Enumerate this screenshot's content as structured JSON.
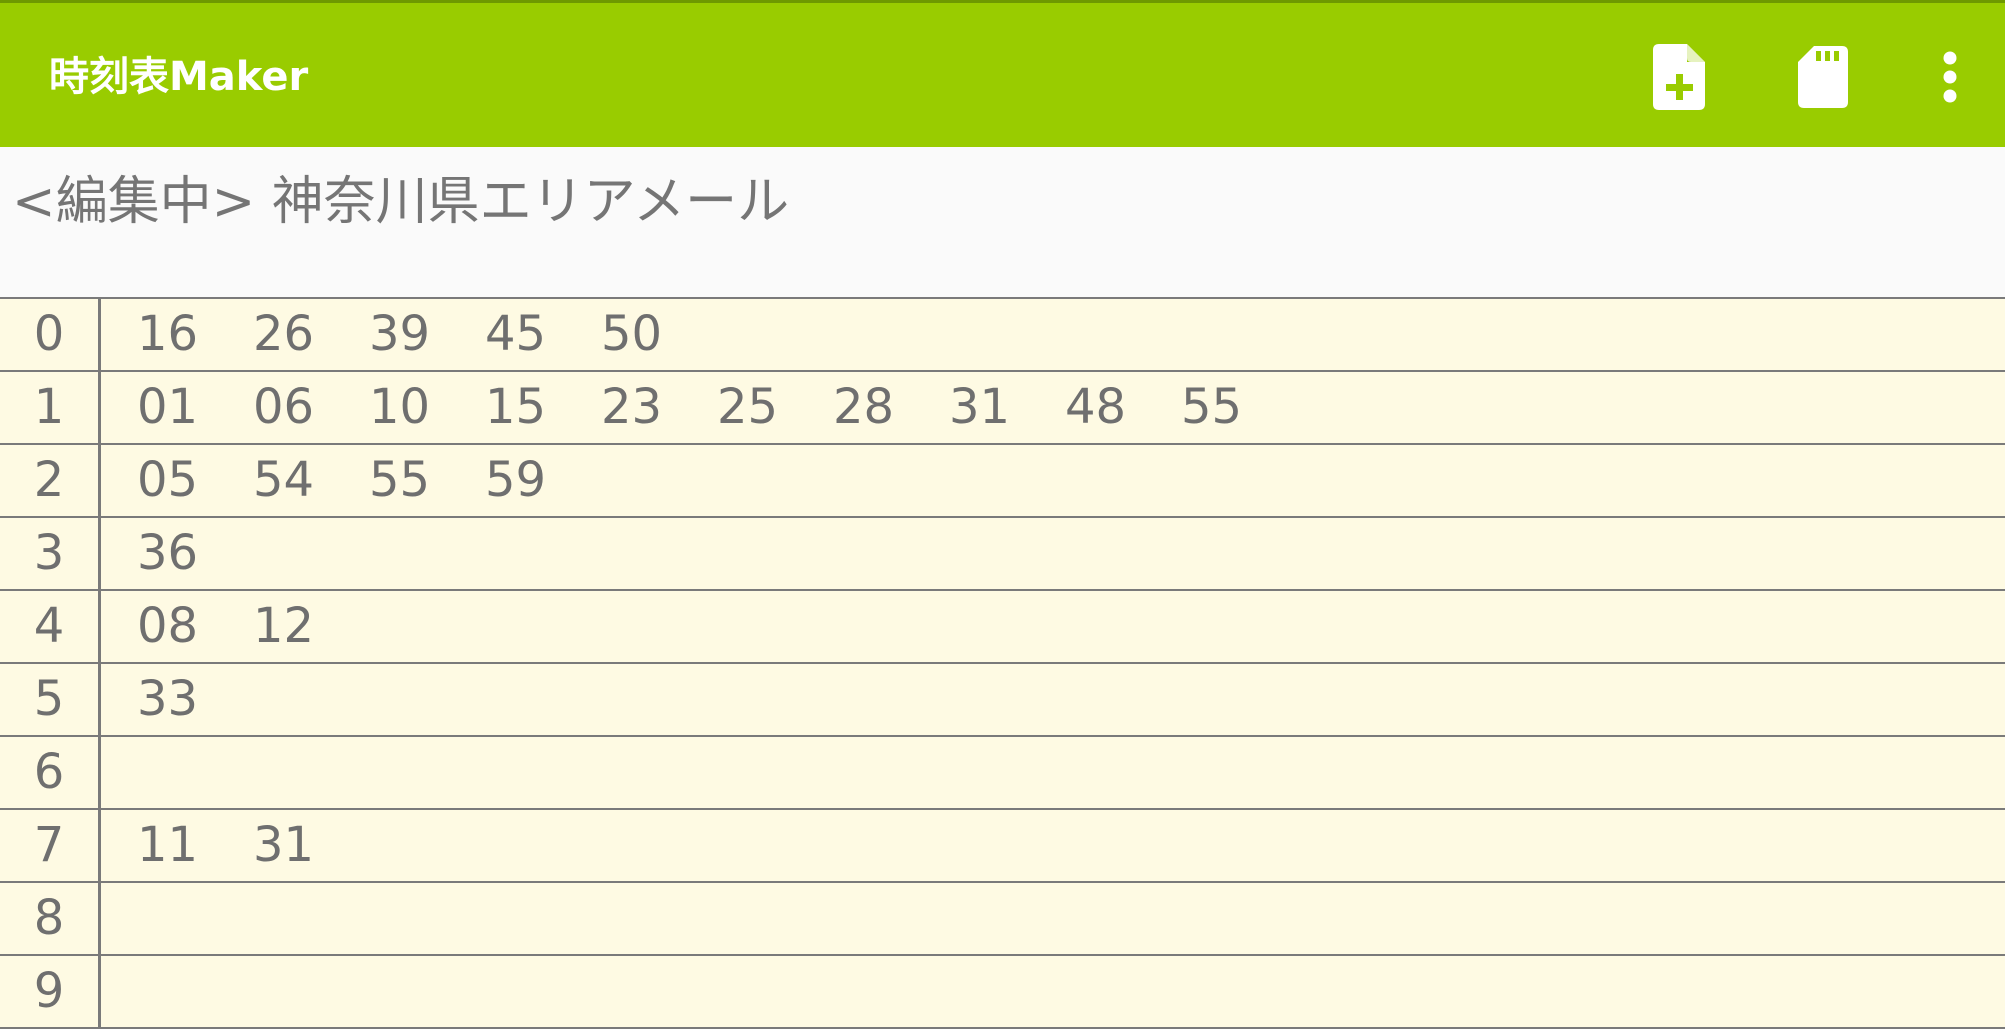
{
  "app": {
    "title": "時刻表Maker",
    "colors": {
      "app_bar": "#99cc00",
      "timetable_background": "#fefae3",
      "grid_lines": "#7a7a7a",
      "text": "#6f6f6f"
    }
  },
  "toolbar": {
    "actions": [
      {
        "icon": "new-file-plus-icon"
      },
      {
        "icon": "sd-card-icon"
      },
      {
        "icon": "more-vert-icon"
      }
    ]
  },
  "editor": {
    "label": "<編集中> 神奈川県エリアメール"
  },
  "timetable": {
    "rows": [
      {
        "hour": "0",
        "minutes": [
          "16",
          "26",
          "39",
          "45",
          "50"
        ]
      },
      {
        "hour": "1",
        "minutes": [
          "01",
          "06",
          "10",
          "15",
          "23",
          "25",
          "28",
          "31",
          "48",
          "55"
        ]
      },
      {
        "hour": "2",
        "minutes": [
          "05",
          "54",
          "55",
          "59"
        ]
      },
      {
        "hour": "3",
        "minutes": [
          "36"
        ]
      },
      {
        "hour": "4",
        "minutes": [
          "08",
          "12"
        ]
      },
      {
        "hour": "5",
        "minutes": [
          "33"
        ]
      },
      {
        "hour": "6",
        "minutes": []
      },
      {
        "hour": "7",
        "minutes": [
          "11",
          "31"
        ]
      },
      {
        "hour": "8",
        "minutes": []
      },
      {
        "hour": "9",
        "minutes": []
      }
    ]
  }
}
